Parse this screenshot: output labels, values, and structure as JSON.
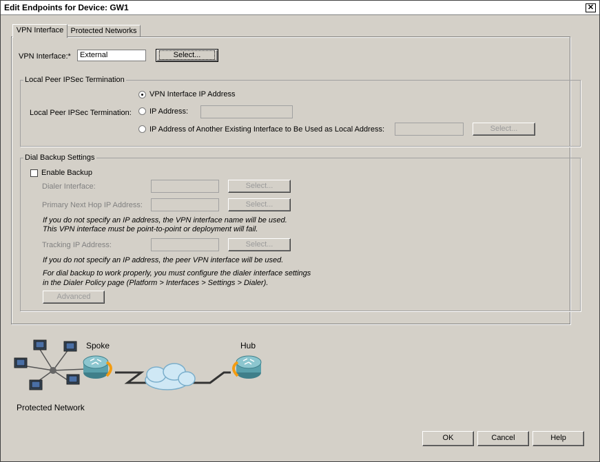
{
  "window": {
    "title": "Edit Endpoints for Device: GW1",
    "close_glyph": "✕"
  },
  "tabs": [
    {
      "label": "VPN Interface",
      "active": true
    },
    {
      "label": "Protected Networks",
      "active": false
    }
  ],
  "vpn_interface": {
    "label": "VPN Interface:*",
    "value": "External",
    "select_label": "Select..."
  },
  "local_peer": {
    "group_title": "Local Peer IPSec Termination",
    "row_label": "Local Peer IPSec Termination:",
    "options": [
      {
        "label": "VPN Interface IP Address",
        "selected": true
      },
      {
        "label": "IP Address:",
        "selected": false
      },
      {
        "label": "IP Address of Another Existing Interface to Be Used as Local Address:",
        "selected": false
      }
    ],
    "ip_value": "",
    "other_value": "",
    "select_label": "Select..."
  },
  "dial_backup": {
    "group_title": "Dial Backup Settings",
    "enable_label": "Enable Backup",
    "enabled": false,
    "dialer_label": "Dialer Interface:",
    "primary_label": "Primary Next Hop IP Address:",
    "tracking_label": "Tracking IP Address:",
    "select_label": "Select...",
    "note1_line1": "If you do not specify an IP address, the VPN interface name will be used.",
    "note1_line2": "This VPN interface must be point-to-point or deployment will fail.",
    "note2": "If you do not specify an IP address, the peer VPN interface will be used.",
    "note3_line1": "For dial backup to work properly, you must configure the dialer interface settings",
    "note3_line2": "in the Dialer Policy page (Platform > Interfaces > Settings > Dialer).",
    "advanced_label": "Advanced"
  },
  "diagram": {
    "spoke_label": "Spoke",
    "hub_label": "Hub",
    "network_label": "Protected Network"
  },
  "footer": {
    "ok": "OK",
    "cancel": "Cancel",
    "help": "Help"
  }
}
